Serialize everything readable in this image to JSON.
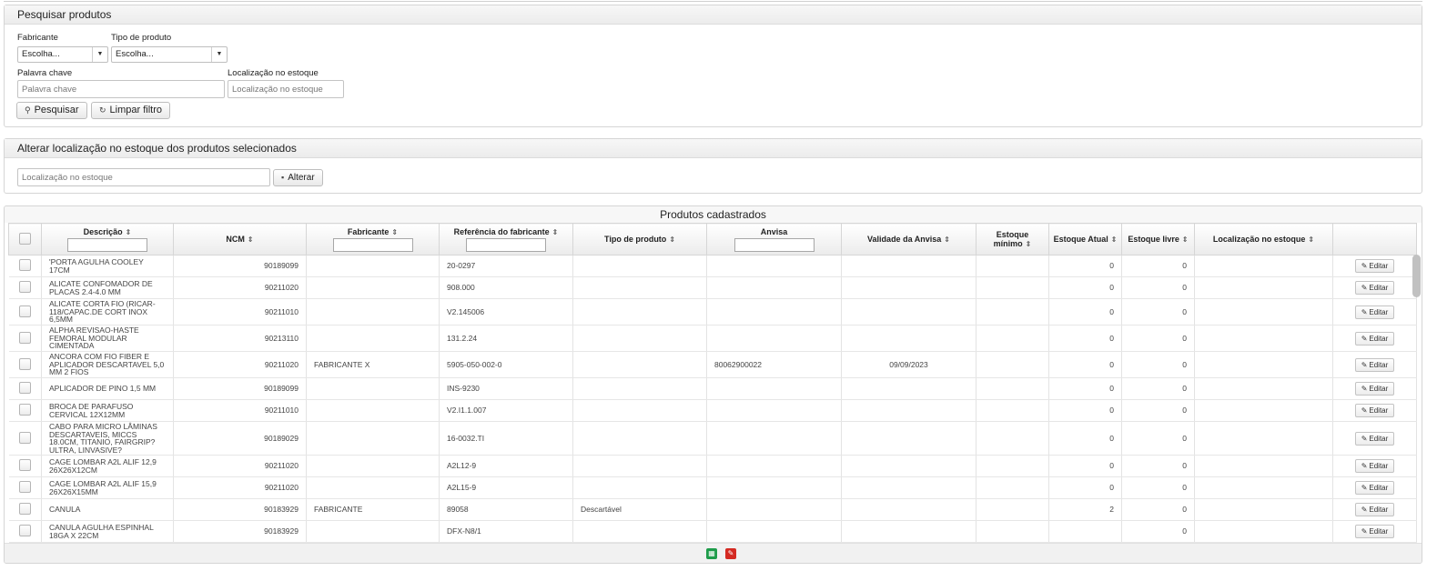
{
  "search": {
    "title": "Pesquisar produtos",
    "manufacturer_label": "Fabricante",
    "manufacturer_value": "Escolha...",
    "product_type_label": "Tipo de produto",
    "product_type_value": "Escolha...",
    "keyword_label": "Palavra chave",
    "keyword_placeholder": "Palavra chave",
    "location_label": "Localização no estoque",
    "location_placeholder": "Localização no estoque",
    "search_button": "Pesquisar",
    "clear_button": "Limpar filtro"
  },
  "alter": {
    "title": "Alterar localização no estoque dos produtos selecionados",
    "location_placeholder": "Localização no estoque",
    "alter_button": "Alterar"
  },
  "grid": {
    "title": "Produtos cadastrados",
    "columns": {
      "descricao": "Descrição",
      "ncm": "NCM",
      "fabricante": "Fabricante",
      "referencia": "Referência do fabricante",
      "tipo": "Tipo de produto",
      "anvisa": "Anvisa",
      "validade": "Validade da Anvisa",
      "estoque_minimo": "Estoque mínimo",
      "estoque_atual": "Estoque Atual",
      "estoque_livre": "Estoque livre",
      "localizacao": "Localização no estoque"
    },
    "edit_label": "Editar",
    "rows": [
      {
        "descricao": "'PORTA AGULHA COOLEY 17CM",
        "ncm": "90189099",
        "fabricante": "",
        "referencia": "20-0297",
        "tipo": "",
        "anvisa": "",
        "validade": "",
        "estoque_minimo": "",
        "estoque_atual": "0",
        "estoque_livre": "0",
        "localizacao": ""
      },
      {
        "descricao": "ALICATE CONFOMADOR DE PLACAS 2.4-4.0 MM",
        "ncm": "90211020",
        "fabricante": "",
        "referencia": "908.000",
        "tipo": "",
        "anvisa": "",
        "validade": "",
        "estoque_minimo": "",
        "estoque_atual": "0",
        "estoque_livre": "0",
        "localizacao": ""
      },
      {
        "descricao": "ALICATE CORTA FIO (RICAR-118/CAPAC.DE CORT INOX 6,5MM",
        "ncm": "90211010",
        "fabricante": "",
        "referencia": "V2.145006",
        "tipo": "",
        "anvisa": "",
        "validade": "",
        "estoque_minimo": "",
        "estoque_atual": "0",
        "estoque_livre": "0",
        "localizacao": ""
      },
      {
        "descricao": "ALPHA REVISAO-HASTE FEMORAL MODULAR CIMENTADA",
        "ncm": "90213110",
        "fabricante": "",
        "referencia": "131.2.24",
        "tipo": "",
        "anvisa": "",
        "validade": "",
        "estoque_minimo": "",
        "estoque_atual": "0",
        "estoque_livre": "0",
        "localizacao": ""
      },
      {
        "descricao": "ANCORA COM FIO FIBER E APLICADOR DESCARTAVEL 5,0 MM 2 FIOS",
        "ncm": "90211020",
        "fabricante": "FABRICANTE X",
        "referencia": "5905-050-002-0",
        "tipo": "",
        "anvisa": "80062900022",
        "validade": "09/09/2023",
        "estoque_minimo": "",
        "estoque_atual": "0",
        "estoque_livre": "0",
        "localizacao": ""
      },
      {
        "descricao": "APLICADOR DE PINO 1,5 MM",
        "ncm": "90189099",
        "fabricante": "",
        "referencia": "INS-9230",
        "tipo": "",
        "anvisa": "",
        "validade": "",
        "estoque_minimo": "",
        "estoque_atual": "0",
        "estoque_livre": "0",
        "localizacao": ""
      },
      {
        "descricao": "BROCA DE PARAFUSO CERVICAL 12X12MM",
        "ncm": "90211010",
        "fabricante": "",
        "referencia": "V2.I1.1.007",
        "tipo": "",
        "anvisa": "",
        "validade": "",
        "estoque_minimo": "",
        "estoque_atual": "0",
        "estoque_livre": "0",
        "localizacao": ""
      },
      {
        "descricao": "CABO PARA MICRO LÂMINAS DESCARTAVEIS, MICCS 18.0CM, TITANIO, FAIRGRIP? ULTRA, LINVASIVE?",
        "ncm": "90189029",
        "fabricante": "",
        "referencia": "16-0032.TI",
        "tipo": "",
        "anvisa": "",
        "validade": "",
        "estoque_minimo": "",
        "estoque_atual": "0",
        "estoque_livre": "0",
        "localizacao": ""
      },
      {
        "descricao": "CAGE LOMBAR A2L ALIF 12,9 26X26X12CM",
        "ncm": "90211020",
        "fabricante": "",
        "referencia": "A2L12-9",
        "tipo": "",
        "anvisa": "",
        "validade": "",
        "estoque_minimo": "",
        "estoque_atual": "0",
        "estoque_livre": "0",
        "localizacao": ""
      },
      {
        "descricao": "CAGE LOMBAR A2L ALIF 15,9 26X26X15MM",
        "ncm": "90211020",
        "fabricante": "",
        "referencia": "A2L15-9",
        "tipo": "",
        "anvisa": "",
        "validade": "",
        "estoque_minimo": "",
        "estoque_atual": "0",
        "estoque_livre": "0",
        "localizacao": ""
      },
      {
        "descricao": "CANULA",
        "ncm": "90183929",
        "fabricante": "FABRICANTE",
        "referencia": "89058",
        "tipo": "Descartável",
        "anvisa": "",
        "validade": "",
        "estoque_minimo": "",
        "estoque_atual": "2",
        "estoque_livre": "0",
        "localizacao": ""
      },
      {
        "descricao": "CANULA AGULHA ESPINHAL 18GA X 22CM",
        "ncm": "90183929",
        "fabricante": "",
        "referencia": "DFX-N8/1",
        "tipo": "",
        "anvisa": "",
        "validade": "",
        "estoque_minimo": "",
        "estoque_atual": "",
        "estoque_livre": "0",
        "localizacao": ""
      }
    ]
  },
  "icons": {
    "sort": "sort-icon",
    "search": "search-icon",
    "refresh": "refresh-icon",
    "save": "save-icon",
    "pencil": "pencil-icon",
    "excel": "excel-export-icon",
    "pdf": "pdf-export-icon"
  },
  "colors": {
    "excel": "#1e9c4a",
    "pdf": "#d42a22"
  }
}
